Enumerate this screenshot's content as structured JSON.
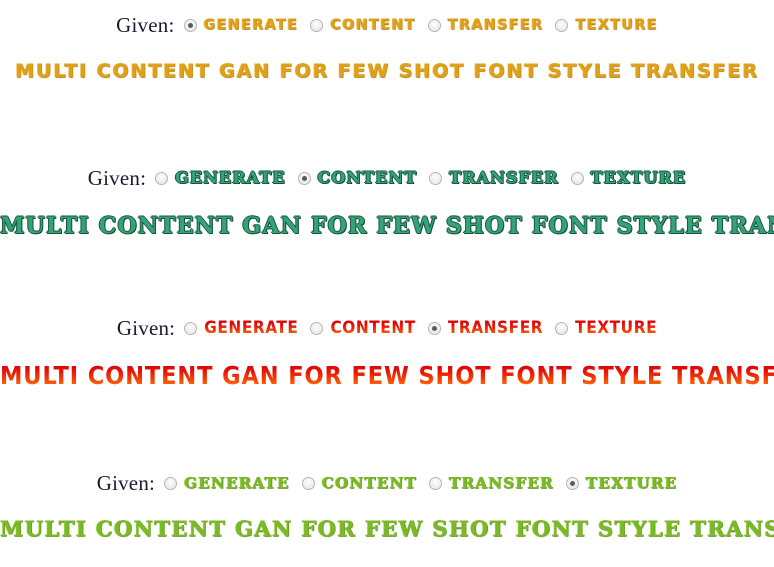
{
  "page": {
    "given_label": "Given:",
    "options": [
      "GENERATE",
      "CONTENT",
      "TRANSFER",
      "TEXTURE"
    ],
    "headline_text": "MULTI CONTENT GAN FOR FEW SHOT FONT STYLE TRANSFER"
  },
  "blocks": [
    {
      "style_name": "gold",
      "color": "#e0a11a",
      "given_label": "Given:",
      "selected_option": "GENERATE",
      "selected_index": 0,
      "options": [
        {
          "label": "GENERATE",
          "checked": true
        },
        {
          "label": "CONTENT",
          "checked": false
        },
        {
          "label": "TRANSFER",
          "checked": false
        },
        {
          "label": "TEXTURE",
          "checked": false
        }
      ],
      "headline": "MULTI CONTENT GAN FOR FEW SHOT FONT STYLE TRANSFER"
    },
    {
      "style_name": "green",
      "color": "#35a378",
      "given_label": "Given:",
      "selected_option": "CONTENT",
      "selected_index": 1,
      "options": [
        {
          "label": "GENERATE",
          "checked": false
        },
        {
          "label": "CONTENT",
          "checked": true
        },
        {
          "label": "TRANSFER",
          "checked": false
        },
        {
          "label": "TEXTURE",
          "checked": false
        }
      ],
      "headline": "MULTI CONTENT GAN FOR FEW SHOT FONT STYLE TRANSFER"
    },
    {
      "style_name": "red",
      "color": "#e81208",
      "given_label": "Given:",
      "selected_option": "TRANSFER",
      "selected_index": 2,
      "options": [
        {
          "label": "GENERATE",
          "checked": false
        },
        {
          "label": "CONTENT",
          "checked": false
        },
        {
          "label": "TRANSFER",
          "checked": true
        },
        {
          "label": "TEXTURE",
          "checked": false
        }
      ],
      "headline": "MULTI CONTENT GAN FOR FEW SHOT FONT STYLE TRANSFER"
    },
    {
      "style_name": "lime",
      "color": "#7cb928",
      "given_label": "Given:",
      "selected_option": "TEXTURE",
      "selected_index": 3,
      "options": [
        {
          "label": "GENERATE",
          "checked": false
        },
        {
          "label": "CONTENT",
          "checked": false
        },
        {
          "label": "TRANSFER",
          "checked": false
        },
        {
          "label": "TEXTURE",
          "checked": true
        }
      ],
      "headline": "MULTI CONTENT GAN FOR FEW SHOT FONT STYLE TRANSFER"
    }
  ]
}
